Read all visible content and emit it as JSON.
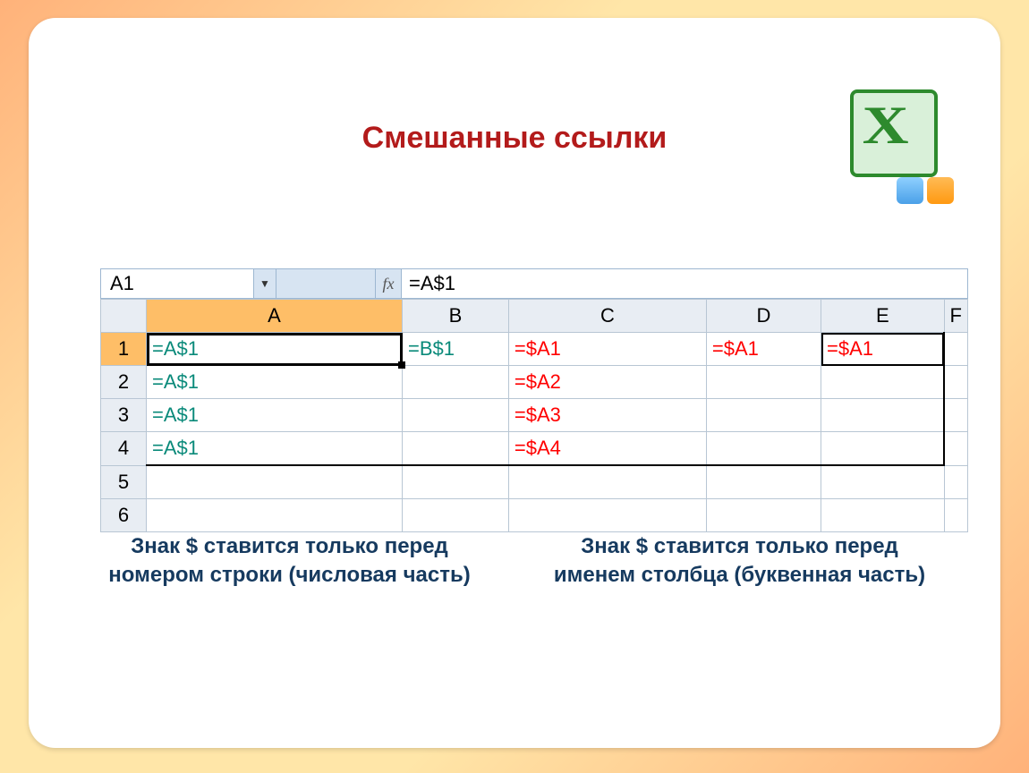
{
  "title": "Смешанные ссылки",
  "namebox": "A1",
  "fx": "fx",
  "formula": "=A$1",
  "columns": {
    "A": "A",
    "B": "B",
    "C": "C",
    "D": "D",
    "E": "E",
    "F": "F"
  },
  "rows": {
    "1": "1",
    "2": "2",
    "3": "3",
    "4": "4",
    "5": "5",
    "6": "6"
  },
  "cells": {
    "A1": "=A$1",
    "B1": "=B$1",
    "C1": "=$A1",
    "D1": "=$A1",
    "E1": "=$A1",
    "A2": "=A$1",
    "C2": "=$A2",
    "A3": "=A$1",
    "C3": "=$A3",
    "A4": "=A$1",
    "C4": "=$A4"
  },
  "caption_left": "Знак $ ставится только перед номером строки (числовая часть)",
  "caption_right": "Знак $ ставится только перед именем столбца (буквенная часть)"
}
